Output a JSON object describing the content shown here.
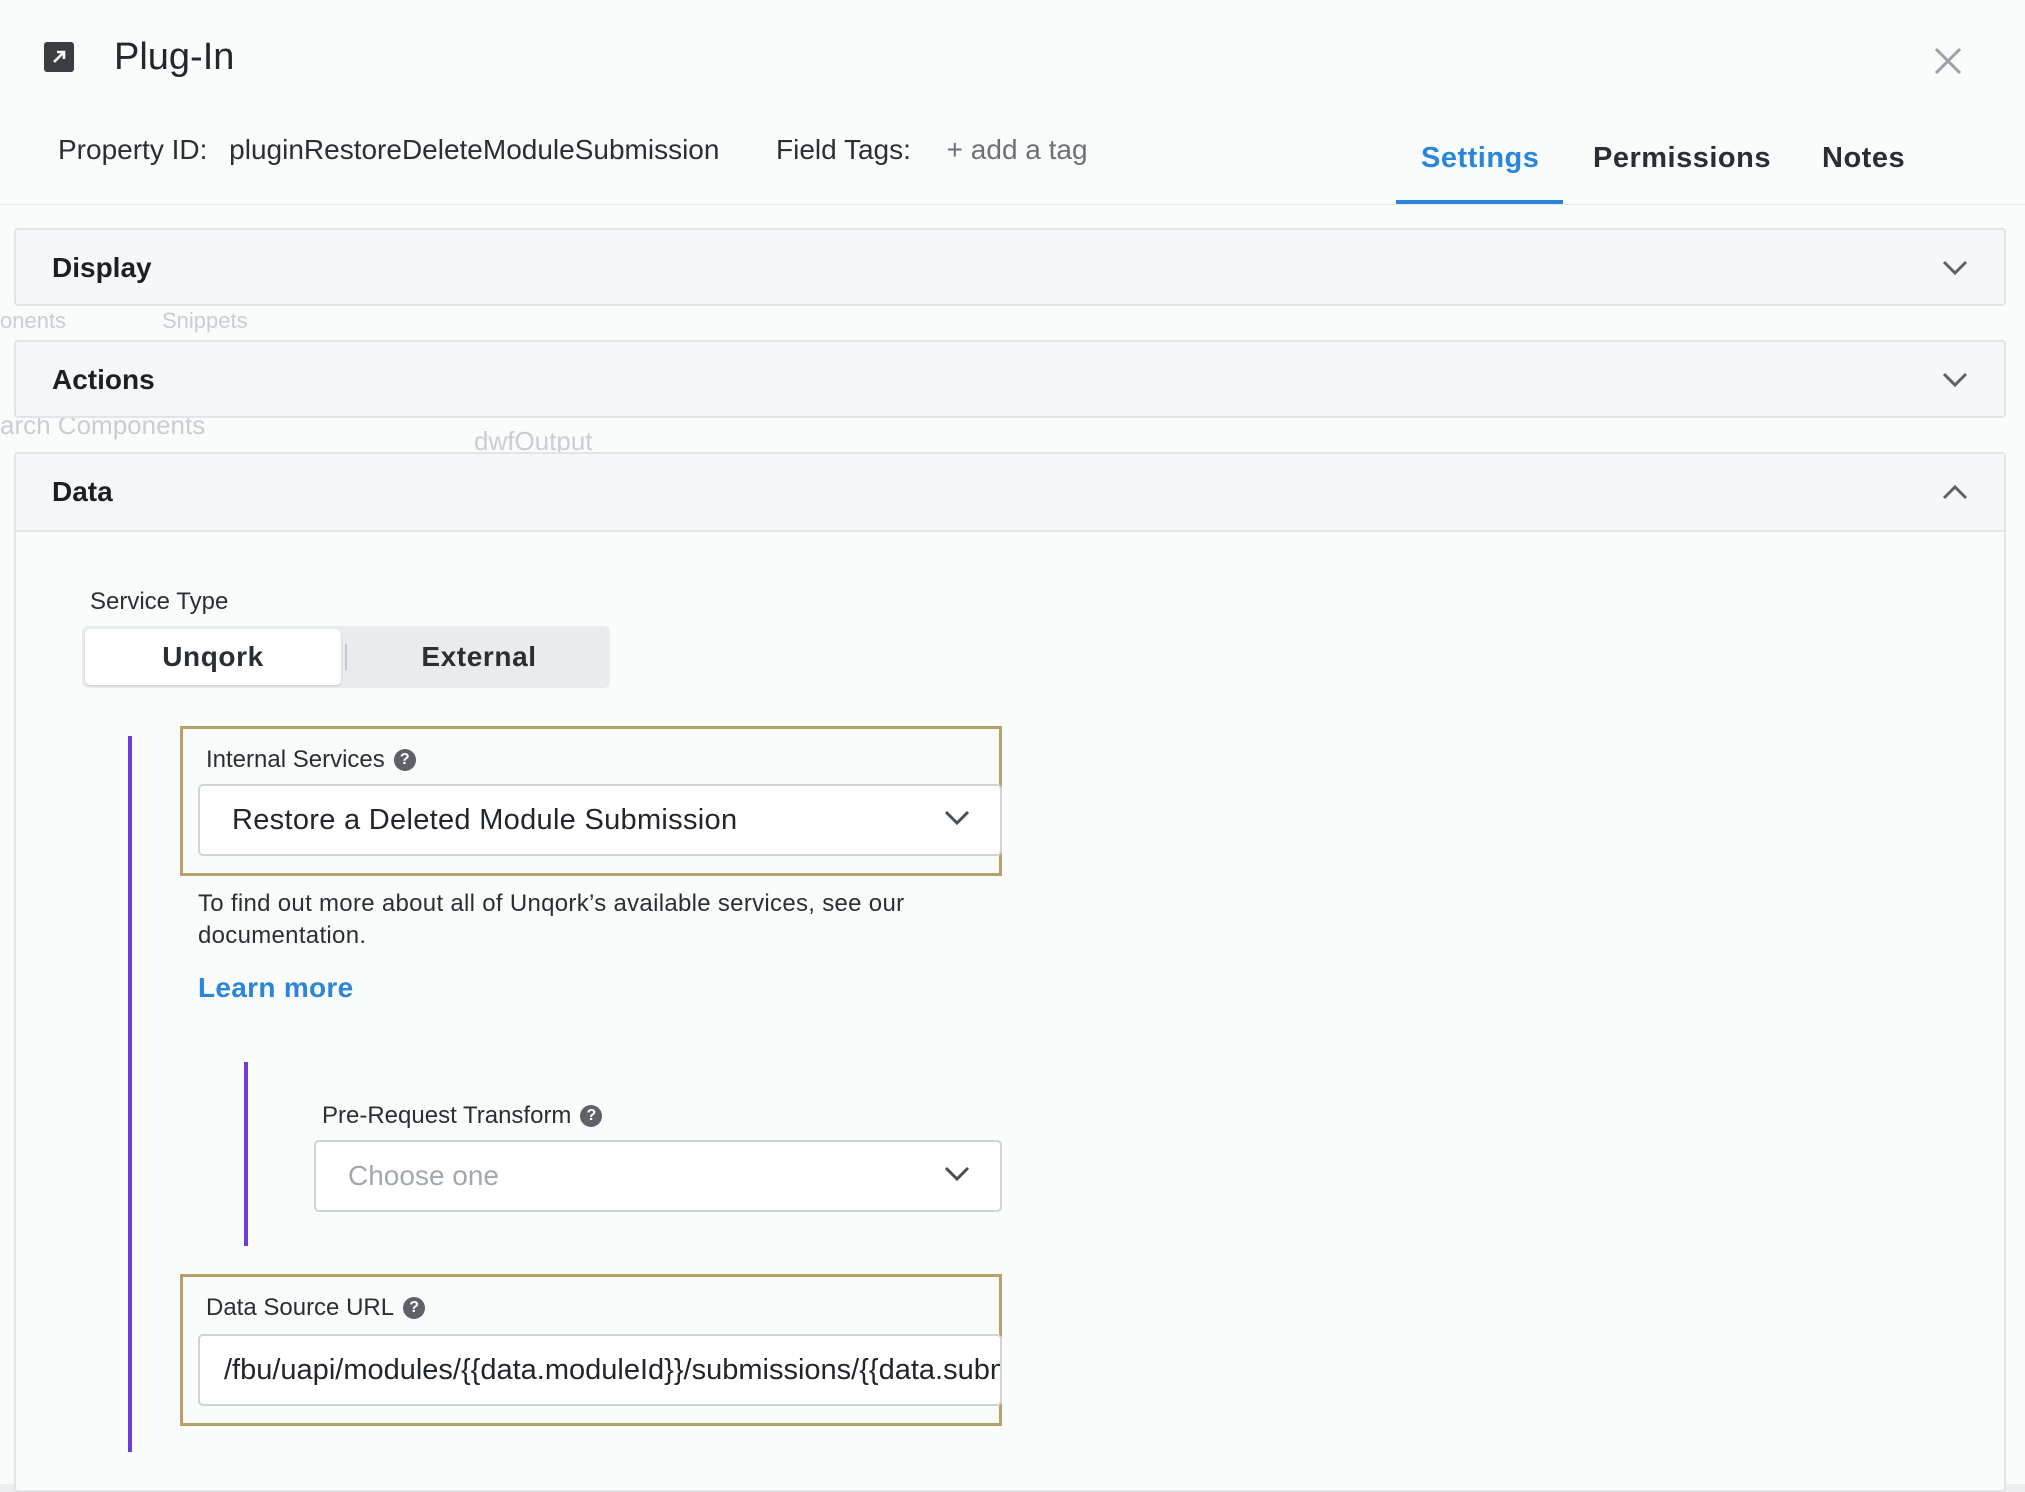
{
  "header": {
    "title": "Plug-In",
    "icon": "external-link-icon",
    "property_id_label": "Property ID:",
    "property_id_value": "pluginRestoreDeleteModuleSubmission",
    "field_tags_label": "Field Tags:",
    "add_tag_label": "+ add a tag"
  },
  "tabs": [
    {
      "label": "Settings",
      "active": true
    },
    {
      "label": "Permissions",
      "active": false
    },
    {
      "label": "Notes",
      "active": false
    }
  ],
  "background_text": {
    "components_tab": "onents",
    "snippets_tab": "Snippets",
    "search_components": "arch Components",
    "canvas_item": "dwfOutput"
  },
  "sections": [
    {
      "label": "Display",
      "expanded": false
    },
    {
      "label": "Actions",
      "expanded": false
    },
    {
      "label": "Data",
      "expanded": true
    }
  ],
  "data": {
    "service_type_label": "Service Type",
    "service_type_options": [
      "Unqork",
      "External"
    ],
    "service_type_selected": "Unqork",
    "internal_services_label": "Internal Services",
    "internal_services_value": "Restore a Deleted Module Submission",
    "help_text": "To find out more about all of Unqork’s available services, see our documentation.",
    "learn_more": "Learn more",
    "pre_request_label": "Pre-Request Transform",
    "pre_request_placeholder": "Choose one",
    "data_source_label": "Data Source URL",
    "data_source_value": "/fbu/uapi/modules/{{data.moduleId}}/submissions/{{data.submissionId}}"
  },
  "colors": {
    "accent": "#2a86d8",
    "highlight_border": "#b5a26a",
    "nest_line": "#6a3fd8"
  }
}
